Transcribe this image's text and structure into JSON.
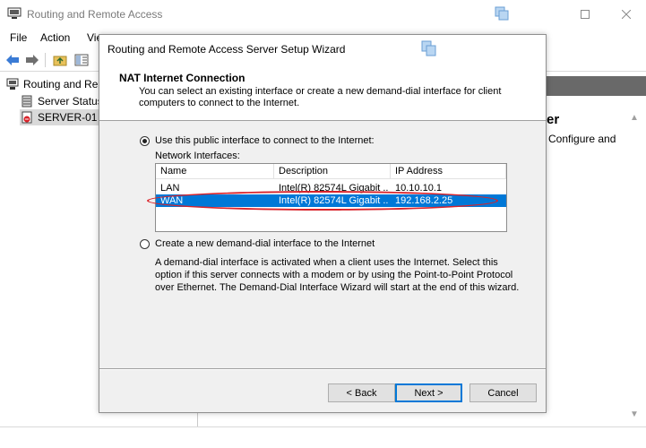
{
  "app": {
    "title": "Routing and Remote Access",
    "menu": [
      "File",
      "Action",
      "Vie"
    ]
  },
  "tree": {
    "items": [
      {
        "label": "Routing and Rem",
        "icon": "server-tree-icon"
      },
      {
        "label": "Server Status",
        "icon": "server-status-icon"
      },
      {
        "label": "SERVER-01 (",
        "icon": "server-down-icon"
      }
    ]
  },
  "result": {
    "heading_fragment": "er",
    "text_fragment": "Configure and"
  },
  "wizard": {
    "title": "Routing and Remote Access Server Setup Wizard",
    "heading": "NAT Internet Connection",
    "subheading": "You can select an existing interface or create a new demand-dial interface for client computers to connect to the Internet.",
    "option_public_label": "Use this public interface to connect to the Internet:",
    "option_public_selected": true,
    "network_interfaces_label": "Network Interfaces:",
    "columns": [
      "Name",
      "Description",
      "IP Address"
    ],
    "rows": [
      {
        "name": "LAN",
        "description": "Intel(R) 82574L Gigabit ...",
        "ip": "10.10.10.1",
        "selected": false
      },
      {
        "name": "WAN",
        "description": "Intel(R) 82574L Gigabit ...",
        "ip": "192.168.2.25",
        "selected": true
      }
    ],
    "option_demand_label": "Create a new demand-dial interface to the Internet",
    "option_demand_selected": false,
    "demand_description": "A demand-dial interface is activated when a client uses the Internet. Select this option if this server connects with a modem or by using the Point-to-Point Protocol over Ethernet. The Demand-Dial Interface Wizard will start at the end of this wizard.",
    "buttons": {
      "back": "< Back",
      "next": "Next >",
      "cancel": "Cancel"
    }
  },
  "colors": {
    "selection": "#0078d7",
    "annotation": "#d9232a",
    "header_bar": "#696969"
  }
}
